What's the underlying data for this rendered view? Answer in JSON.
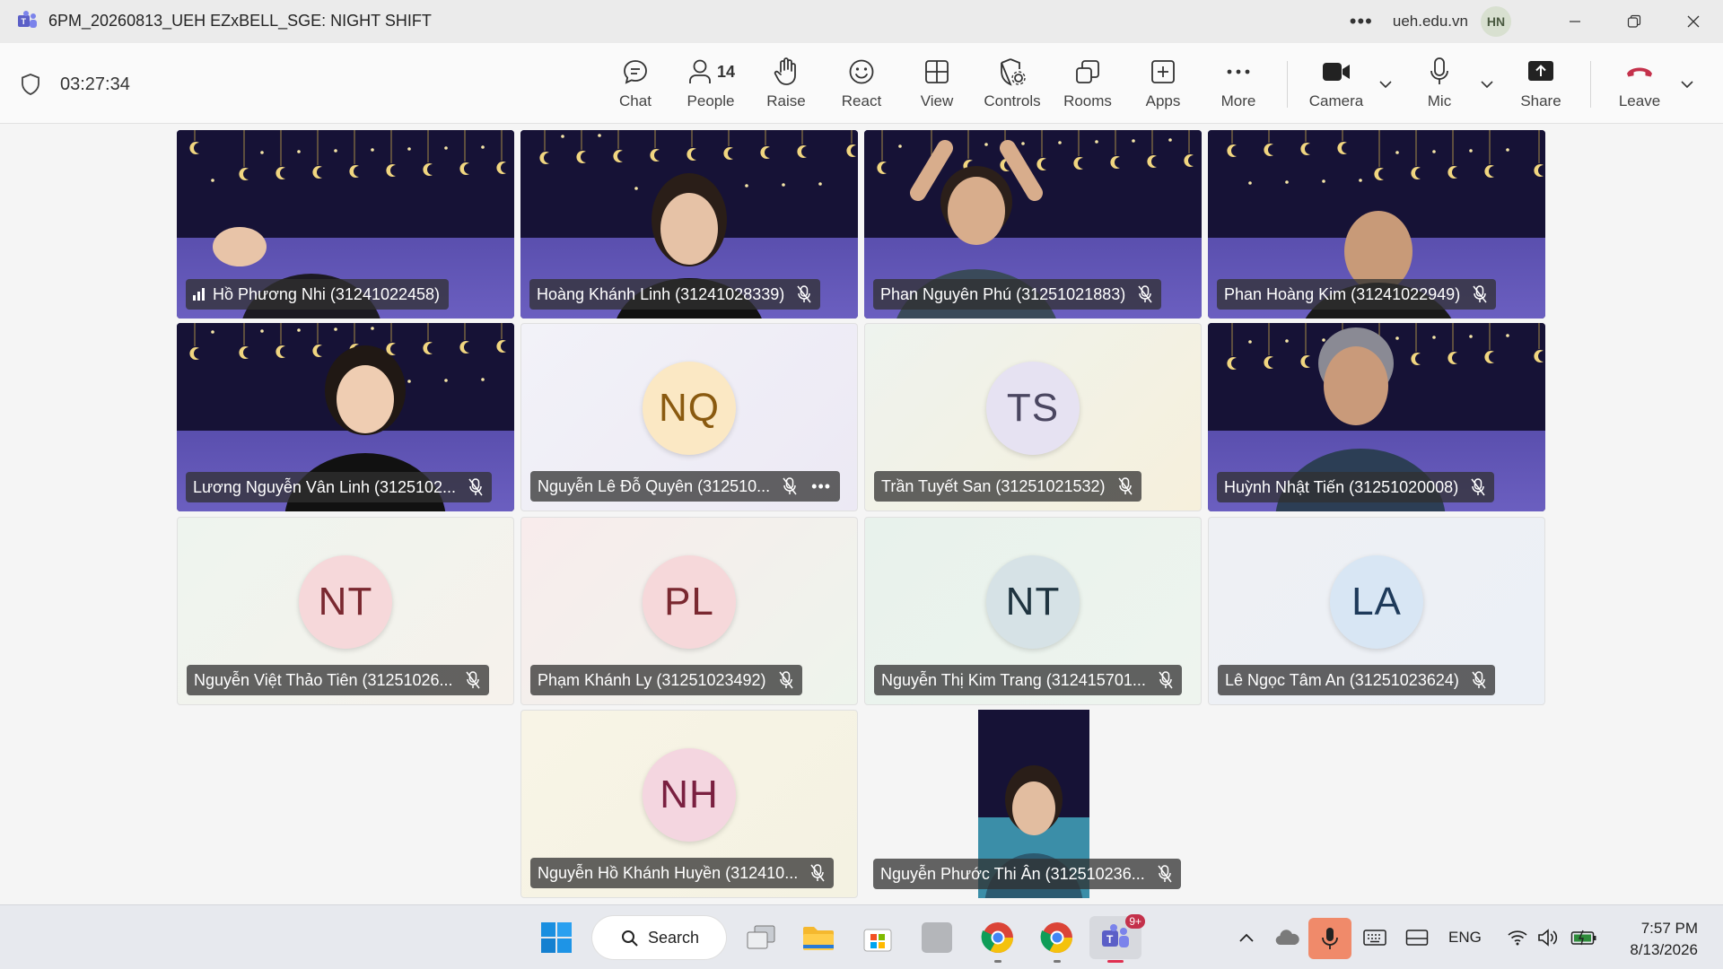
{
  "window": {
    "title": "6PM_20260813_UEH EZxBELL_SGE: NIGHT SHIFT",
    "domain": "ueh.edu.vn",
    "user_initials": "HN"
  },
  "meeting": {
    "timer": "03:27:34",
    "people_count": "14",
    "tools": [
      {
        "label": "Chat",
        "icon": "chat-icon"
      },
      {
        "label": "People",
        "icon": "people-icon"
      },
      {
        "label": "Raise",
        "icon": "hand-icon"
      },
      {
        "label": "React",
        "icon": "smiley-icon"
      },
      {
        "label": "View",
        "icon": "grid-icon"
      },
      {
        "label": "Controls",
        "icon": "shield-gear-icon"
      },
      {
        "label": "Rooms",
        "icon": "rooms-icon"
      },
      {
        "label": "Apps",
        "icon": "plus-square-icon"
      },
      {
        "label": "More",
        "icon": "ellipsis-icon"
      },
      {
        "label": "Camera",
        "icon": "camera-icon"
      },
      {
        "label": "Mic",
        "icon": "mic-icon"
      },
      {
        "label": "Share",
        "icon": "share-icon"
      },
      {
        "label": "Leave",
        "icon": "hangup-icon"
      }
    ]
  },
  "participants": [
    {
      "name": "Hồ Phương Nhi (31241022458)",
      "type": "video"
    },
    {
      "name": "Hoàng Khánh Linh (31241028339)",
      "type": "video"
    },
    {
      "name": "Phan Nguyên Phú (31251021883)",
      "type": "video"
    },
    {
      "name": "Phan Hoàng Kim (31241022949)",
      "type": "video"
    },
    {
      "name": "Lương Nguyễn Vân Linh (3125102...",
      "type": "video"
    },
    {
      "name": "Nguyễn Lê Đỗ Quyên (312510...",
      "type": "avatar",
      "initials": "NQ"
    },
    {
      "name": "Trần Tuyết San (31251021532)",
      "type": "avatar",
      "initials": "TS"
    },
    {
      "name": "Huỳnh Nhật Tiến (31251020008)",
      "type": "video"
    },
    {
      "name": "Nguyễn Việt Thảo Tiên (31251026...",
      "type": "avatar",
      "initials": "NT"
    },
    {
      "name": "Phạm Khánh Ly (31251023492)",
      "type": "avatar",
      "initials": "PL"
    },
    {
      "name": "Nguyễn Thị Kim Trang (312415701...",
      "type": "avatar",
      "initials": "NT"
    },
    {
      "name": "Lê Ngọc Tâm An (31251023624)",
      "type": "avatar",
      "initials": "LA"
    },
    {
      "name": "Nguyễn Hồ Khánh Huyền (312410...",
      "type": "avatar",
      "initials": "NH"
    },
    {
      "name": "Nguyễn Phước Thi Ân (312510236...",
      "type": "video"
    }
  ],
  "taskbar": {
    "search_label": "Search",
    "teams_badge": "9+",
    "language": "ENG",
    "time": "7:57 PM",
    "date": "8/13/2026"
  },
  "colors": {
    "leave_red": "#c4314b",
    "mic_active": "#f08a6a"
  }
}
